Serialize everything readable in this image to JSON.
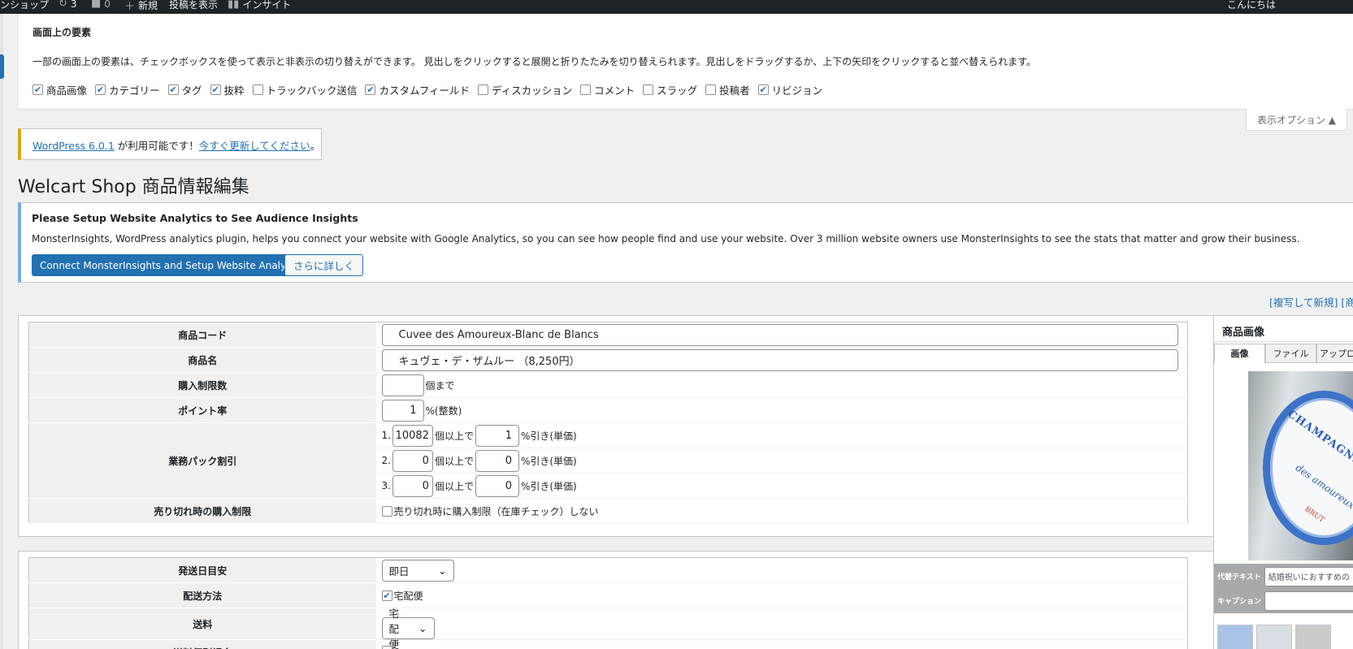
{
  "adminbar": {
    "site": "ンショップ",
    "updates_count": "3",
    "comments_count": "0",
    "new": "新規",
    "view_post": "投稿を表示",
    "insights": "インサイト",
    "greeting": "こんにちは"
  },
  "screen_options": {
    "title": "画面上の要素",
    "description": "一部の画面上の要素は、チェックボックスを使って表示と非表示の切り替えができます。 見出しをクリックすると展開と折りたたみを切り替えられます。見出しをドラッグするか、上下の矢印をクリックすると並べ替えられます。",
    "options": [
      {
        "label": "商品画像",
        "checked": true
      },
      {
        "label": "カテゴリー",
        "checked": true
      },
      {
        "label": "タグ",
        "checked": true
      },
      {
        "label": "抜粋",
        "checked": true
      },
      {
        "label": "トラックバック送信",
        "checked": false
      },
      {
        "label": "カスタムフィールド",
        "checked": true
      },
      {
        "label": "ディスカッション",
        "checked": false
      },
      {
        "label": "コメント",
        "checked": false
      },
      {
        "label": "スラッグ",
        "checked": false
      },
      {
        "label": "投稿者",
        "checked": false
      },
      {
        "label": "リビジョン",
        "checked": true
      }
    ],
    "toggle_label": "表示オプション ▲"
  },
  "update_nag": {
    "version_link": "WordPress 6.0.1",
    "text": " が利用可能です！",
    "update_link": "今すぐ更新してください",
    "suffix": "。"
  },
  "page_title": "Welcart Shop 商品情報編集",
  "monsterinsights": {
    "title": "Please Setup Website Analytics to See Audience Insights",
    "description": "MonsterInsights, WordPress analytics plugin, helps you connect your website with Google Analytics, so you can see how people find and use your website. Over 3 million website owners use MonsterInsights to see the stats that matter and grow their business.",
    "connect_button": "Connect MonsterInsights and Setup Website Analytics",
    "more_button": "さらに詳しく"
  },
  "copy_links": "[複写して新規] [商品",
  "item": {
    "code_label": "商品コード",
    "code_value": "Cuvee des Amoureux-Blanc de Blancs",
    "name_label": "商品名",
    "name_value": "キュヴェ・デ・ザムルー （8,250円）",
    "limit_label": "購入制限数",
    "limit_value": "",
    "limit_unit": "個まで",
    "point_label": "ポイント率",
    "point_value": "1",
    "point_unit": "%(整数)",
    "pack_label": "業務パック割引",
    "pack_rows": [
      {
        "no": "1.",
        "qty": "10082",
        "qty_unit": "個以上で",
        "rate": "1",
        "rate_unit": "%引き(単価)"
      },
      {
        "no": "2.",
        "qty": "0",
        "qty_unit": "個以上で",
        "rate": "0",
        "rate_unit": "%引き(単価)"
      },
      {
        "no": "3.",
        "qty": "0",
        "qty_unit": "個以上で",
        "rate": "0",
        "rate_unit": "%引き(単価)"
      }
    ],
    "soldout_label": "売り切れ時の購入制限",
    "soldout_text": "売り切れ時に購入制限（在庫チェック）しない",
    "soldout_checked": false
  },
  "shipping": {
    "date_label": "発送日目安",
    "date_value": "即日",
    "method_label": "配送方法",
    "method_option": "宅配便",
    "method_checked": true,
    "fee_label": "送料",
    "fee_value": "宅配便",
    "individual_label": "送料個別課金"
  },
  "product_image": {
    "title": "商品画像",
    "tabs": [
      "画像",
      "ファイル",
      "アップロー"
    ],
    "label_main": "CHAMPAGNE",
    "label_sub": "des amoureux",
    "label_brut": "BRUT",
    "alt_label": "代替テキスト",
    "alt_value": "結婚祝いにおすすめの",
    "caption_label": "キャプション",
    "caption_value": ""
  }
}
